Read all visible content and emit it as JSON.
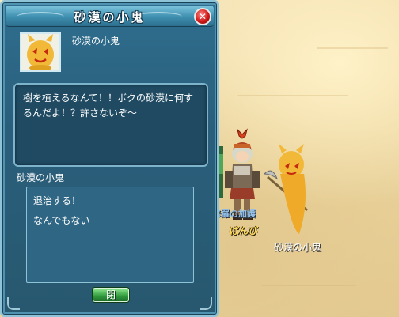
{
  "dialog": {
    "title": "砂漠の小鬼",
    "close_icon_glyph": "✕",
    "npc_name": "砂漠の小鬼",
    "message": "樹を植えるなんて！！ボクの砂漠に何するんだよ！？許さないぞ〜",
    "speaker_label": "砂漠の小鬼",
    "choices": [
      {
        "label": "退治する！"
      },
      {
        "label": "なんでもない"
      }
    ],
    "close_button_label": "閉"
  },
  "world": {
    "player_name": "ぱんぴ",
    "guild_tag": "阿修羅の加護",
    "npc_name": "砂漠の小鬼"
  },
  "colors": {
    "panel": "#2a5f7c",
    "border": "#8fc3d8",
    "close_button": "#d01818",
    "ok_button": "#2f9a3c",
    "sand": "#ecd8a4",
    "player_name": "#ffd85a"
  }
}
